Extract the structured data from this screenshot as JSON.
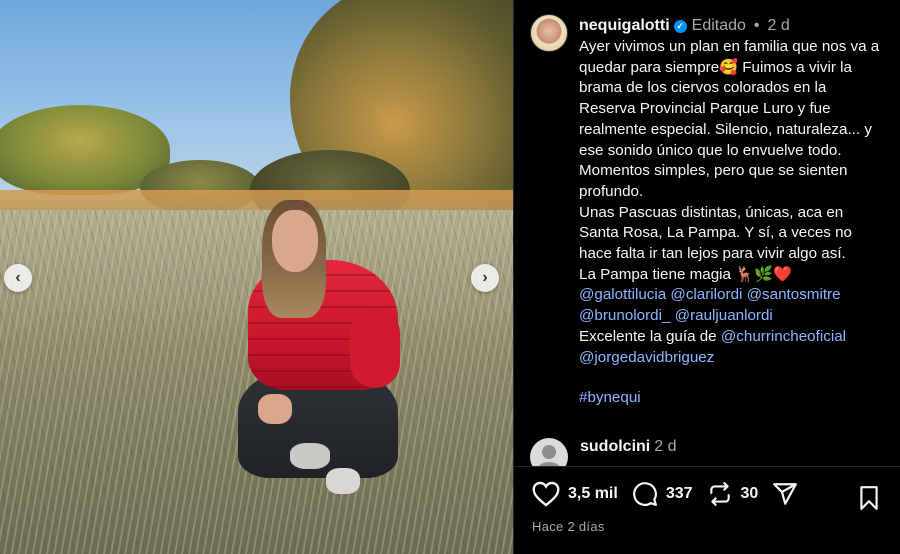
{
  "post": {
    "username": "nequigalotti",
    "edited_label": "Editado",
    "time": "2 d",
    "caption_lines": [
      "Ayer vivimos un plan en familia que nos va a quedar para siempre🥰 Fuimos a vivir la brama de los ciervos colorados  en  la Reserva Provincial Parque Luro y fue realmente especial. Silencio, naturaleza... y ese sonido único que lo envuelve todo. Momentos simples, pero que se sienten profundo.",
      "Unas Pascuas distintas, únicas, aca en Santa Rosa, La Pampa. Y sí, a veces no hace falta ir tan lejos para vivir algo así.",
      "La Pampa tiene magia 🦌🌿❤️"
    ],
    "mentions_line1": [
      "@galottilucia",
      "@clarilordi",
      "@santosmitre"
    ],
    "mentions_line2": [
      "@brunolordi_",
      "@rauljuanlordi"
    ],
    "guide_prefix": "Excelente la guía de ",
    "guide_mention": "@churrincheoficial",
    "guide_mention2": "@jorgedavidbriguez",
    "hashtag": "#bynequi"
  },
  "comment": {
    "username": "sudolcini",
    "time": "2 d"
  },
  "actions": {
    "likes": "3,5 mil",
    "comments": "337",
    "reposts": "30",
    "posted_ago": "Hace 2 días"
  },
  "icons": {
    "like": "heart-icon",
    "comment": "comment-bubble-icon",
    "repost": "repost-icon",
    "share": "send-icon",
    "save": "bookmark-icon",
    "prev": "chevron-left-icon",
    "next": "chevron-right-icon"
  },
  "colors": {
    "background": "#000000",
    "mention": "#8fb4ff",
    "verified": "#0095f6",
    "meta_gray": "#a8a8a8"
  }
}
